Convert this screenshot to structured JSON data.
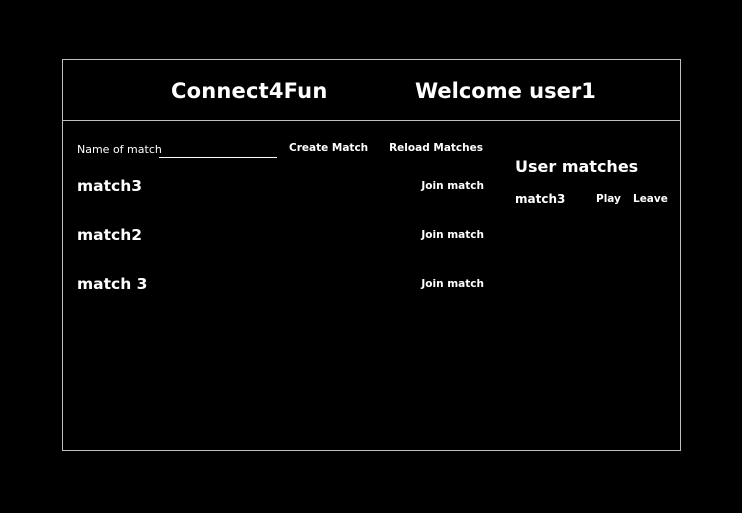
{
  "header": {
    "app_title": "Connect4Fun",
    "welcome_prefix": "Welcome ",
    "username": "user1"
  },
  "create": {
    "name_label": "Name of match",
    "name_value": "",
    "create_label": "Create Match",
    "reload_label": "Reload Matches"
  },
  "matches": [
    {
      "name": "match3",
      "join_label": "Join match"
    },
    {
      "name": "match2",
      "join_label": "Join match"
    },
    {
      "name": "match 3",
      "join_label": "Join match"
    }
  ],
  "user_matches": {
    "title": "User matches",
    "items": [
      {
        "name": "match3",
        "play_label": "Play",
        "leave_label": "Leave"
      }
    ]
  },
  "colors": {
    "background": "#000000",
    "text": "#ffffff",
    "border": "#bfbfbf"
  }
}
